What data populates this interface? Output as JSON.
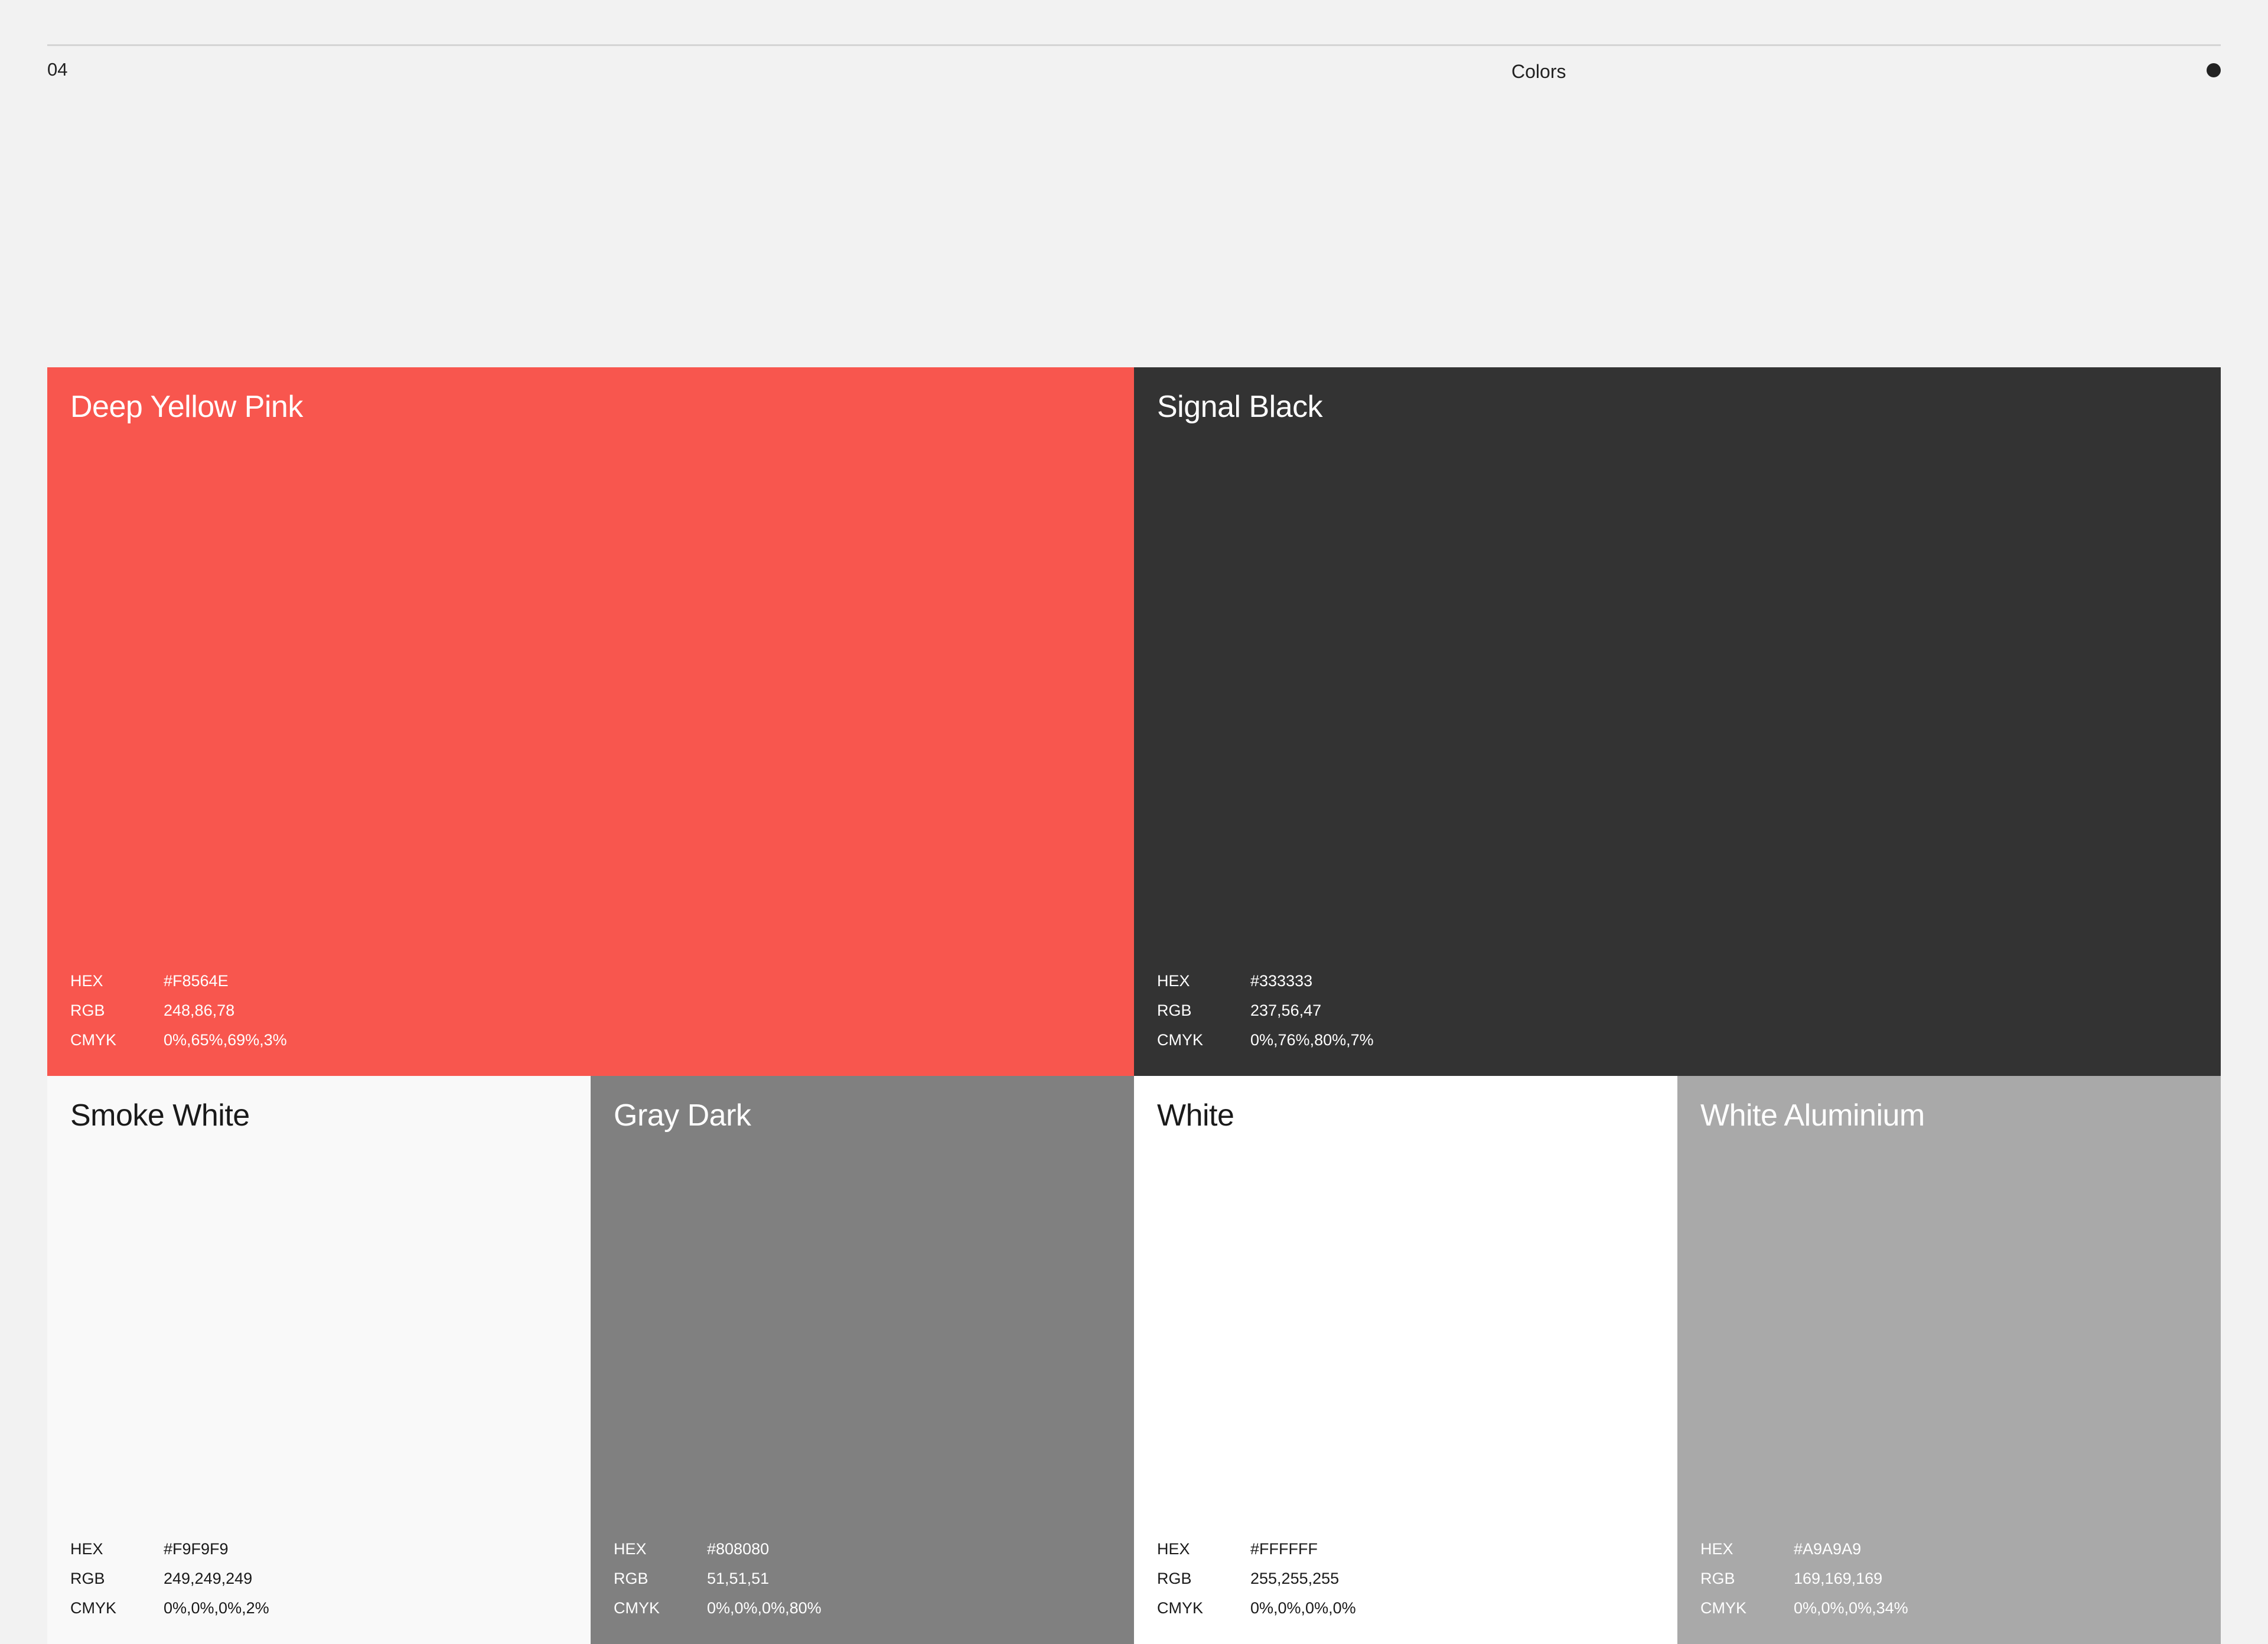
{
  "header": {
    "page_number": "04",
    "title": "Colors"
  },
  "swatches": [
    {
      "name": "Deep Yellow Pink",
      "color": "#F8564E",
      "text_color": "#ffffff",
      "hex_label": "HEX",
      "hex": "#F8564E",
      "rgb_label": "RGB",
      "rgb": "248,86,78",
      "cmyk_label": "CMYK",
      "cmyk": "0%,65%,69%,3%"
    },
    {
      "name": "Signal Black",
      "color": "#333333",
      "text_color": "#ffffff",
      "hex_label": "HEX",
      "hex": "#333333",
      "rgb_label": "RGB",
      "rgb": "237,56,47",
      "cmyk_label": "CMYK",
      "cmyk": "0%,76%,80%,7%"
    },
    {
      "name": "Smoke White",
      "color": "#F9F9F9",
      "text_color": "#1a1a1a",
      "hex_label": "HEX",
      "hex": "#F9F9F9",
      "rgb_label": "RGB",
      "rgb": "249,249,249",
      "cmyk_label": "CMYK",
      "cmyk": "0%,0%,0%,2%"
    },
    {
      "name": "Gray Dark",
      "color": "#808080",
      "text_color": "#ffffff",
      "hex_label": "HEX",
      "hex": "#808080",
      "rgb_label": "RGB",
      "rgb": "51,51,51",
      "cmyk_label": "CMYK",
      "cmyk": "0%,0%,0%,80%"
    },
    {
      "name": "White",
      "color": "#FFFFFF",
      "text_color": "#1a1a1a",
      "hex_label": "HEX",
      "hex": "#FFFFFF",
      "rgb_label": "RGB",
      "rgb": "255,255,255",
      "cmyk_label": "CMYK",
      "cmyk": "0%,0%,0%,0%"
    },
    {
      "name": "White Aluminium",
      "color": "#A9A9A9",
      "text_color": "#ffffff",
      "hex_label": "HEX",
      "hex": "#A9A9A9",
      "rgb_label": "RGB",
      "rgb": "169,169,169",
      "cmyk_label": "CMYK",
      "cmyk": "0%,0%,0%,34%"
    }
  ]
}
